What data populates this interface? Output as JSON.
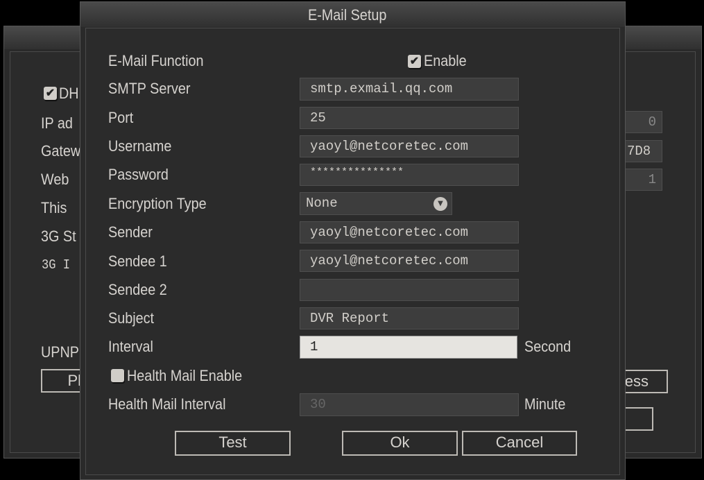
{
  "background_window": {
    "dhcp_label": "DH",
    "dhcp_checked": true,
    "labels": [
      "IP ad",
      "Gatew",
      "Web",
      "This",
      "3G St",
      "3G I",
      "UPNP"
    ],
    "fields": [
      "0",
      "7D8",
      "1"
    ],
    "buttons": [
      "Pl",
      "ess",
      ""
    ]
  },
  "dialog": {
    "title": "E-Mail Setup",
    "email_function": {
      "label": "E-Mail Function",
      "enable_label": "Enable",
      "checked": true
    },
    "smtp_server": {
      "label": "SMTP Server",
      "value": "smtp.exmail.qq.com"
    },
    "port": {
      "label": "Port",
      "value": "25"
    },
    "username": {
      "label": "Username",
      "value": "yaoyl@netcoretec.com"
    },
    "password": {
      "label": "Password",
      "value": "***************"
    },
    "encryption": {
      "label": "Encryption Type",
      "value": "None"
    },
    "sender": {
      "label": "Sender",
      "value": "yaoyl@netcoretec.com"
    },
    "sendee1": {
      "label": "Sendee 1",
      "value": "yaoyl@netcoretec.com"
    },
    "sendee2": {
      "label": "Sendee 2",
      "value": ""
    },
    "subject": {
      "label": "Subject",
      "value": "DVR Report"
    },
    "interval": {
      "label": "Interval",
      "value": "1",
      "unit": "Second"
    },
    "health_mail": {
      "label": "Health Mail Enable",
      "checked": false
    },
    "health_interval": {
      "label": "Health Mail Interval",
      "value": "30",
      "unit": "Minute"
    },
    "buttons": {
      "test": "Test",
      "ok": "Ok",
      "cancel": "Cancel"
    }
  }
}
